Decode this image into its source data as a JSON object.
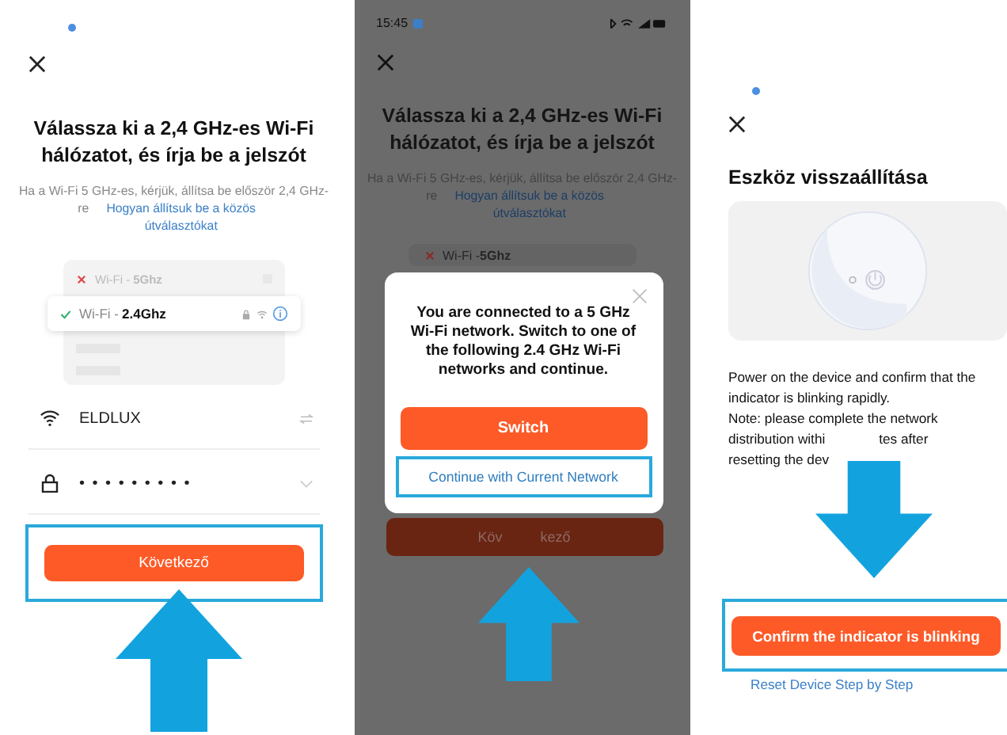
{
  "screen_1": {
    "title": "Válassza ki a 2,4 GHz-es Wi-Fi hálózatot, és írja be a jelszót",
    "hint": "Ha a Wi-Fi 5 GHz-es, kérjük, állítsa be először 2,4 GHz-re",
    "hint_link": "Hogyan állítsuk be a közös útválasztókat",
    "networks": [
      {
        "prefix": "Wi-Fi - ",
        "band": "5Ghz",
        "selected": false
      },
      {
        "prefix": "Wi-Fi - ",
        "band": "2.4Ghz",
        "selected": true
      }
    ],
    "wifi_name": "ELDLUX",
    "password": "• • • • • • • • •",
    "button": "Következő"
  },
  "screen_2": {
    "time": "15:45",
    "title": "Válassza ki a 2,4 GHz-es Wi-Fi hálózatot, és írja be a jelszót",
    "hint": "Ha a Wi-Fi 5 GHz-es, kérjük, állítsa be először 2,4 GHz-re",
    "hint_link": "Hogyan állítsuk be a közös útválasztókat",
    "network": {
      "prefix": "Wi-Fi - ",
      "band": "5Ghz"
    },
    "dialog": {
      "message": "You are connected to a 5 GHz Wi-Fi network. Switch to one of the following 2.4 GHz Wi-Fi networks and continue.",
      "primary": "Switch",
      "secondary": "Continue with Current Network"
    },
    "button_parts": [
      "Köv",
      "kező"
    ]
  },
  "screen_3": {
    "title": "Eszköz visszaállítása",
    "text": "Power on the device and confirm that the indicator is blinking rapidly.",
    "note_lines": [
      [
        "Note: please complete the network"
      ],
      [
        "distribution withi",
        "tes after"
      ],
      [
        "resetting the dev"
      ]
    ],
    "button": "Confirm the indicator is blinking",
    "link": "Reset Device Step by Step"
  }
}
